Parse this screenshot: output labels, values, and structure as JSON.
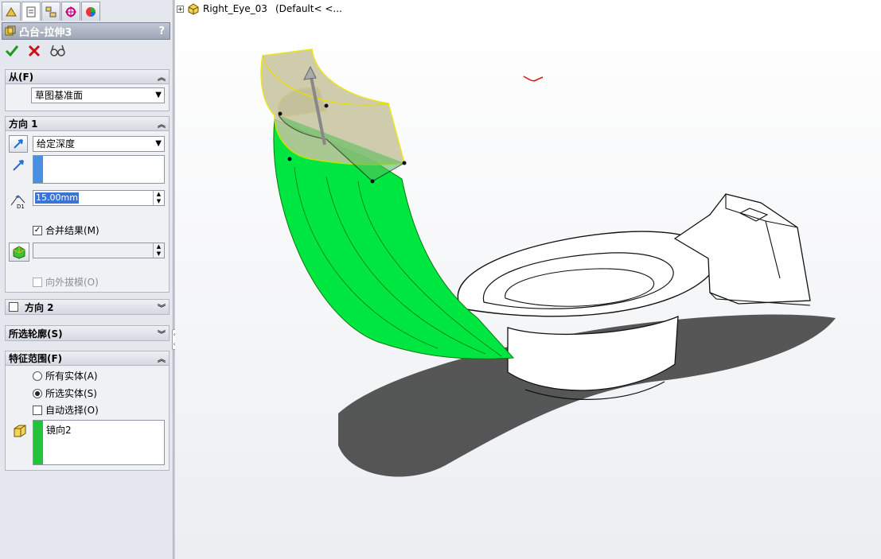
{
  "panel": {
    "tabs": [
      "feature-manager-icon",
      "property-manager-icon",
      "configuration-manager-icon",
      "dimxpert-icon",
      "display-manager-icon"
    ],
    "title": "凸台-拉伸3",
    "help": "?",
    "actions": {
      "ok": "ok-check-icon",
      "cancel": "cancel-x-icon",
      "preview": "preview-glasses-icon"
    }
  },
  "from": {
    "header": "从(F)",
    "value": "草图基准面"
  },
  "direction1": {
    "header": "方向 1",
    "end_condition": "给定深度",
    "depth": "15.00mm",
    "merge_result": {
      "label": "合并结果(M)",
      "checked": true
    },
    "draft_outward": {
      "label": "向外拔模(O)",
      "checked": false
    }
  },
  "direction2": {
    "header": "方向 2",
    "checked": false
  },
  "selected_contours": {
    "header": "所选轮廓(S)"
  },
  "feature_scope": {
    "header": "特征范围(F)",
    "options": [
      {
        "label": "所有实体(A)",
        "selected": false
      },
      {
        "label": "所选实体(S)",
        "selected": true
      }
    ],
    "auto_select": {
      "label": "自动选择(O)",
      "checked": false
    },
    "bodies": [
      "镜向2"
    ]
  },
  "viewport": {
    "tree_item": "Right_Eye_03",
    "tree_config": "(Default< <..."
  },
  "colors": {
    "accent_green": "#00e640",
    "panel_bg": "#e4e7ee",
    "list_blue": "#4a90e2"
  }
}
